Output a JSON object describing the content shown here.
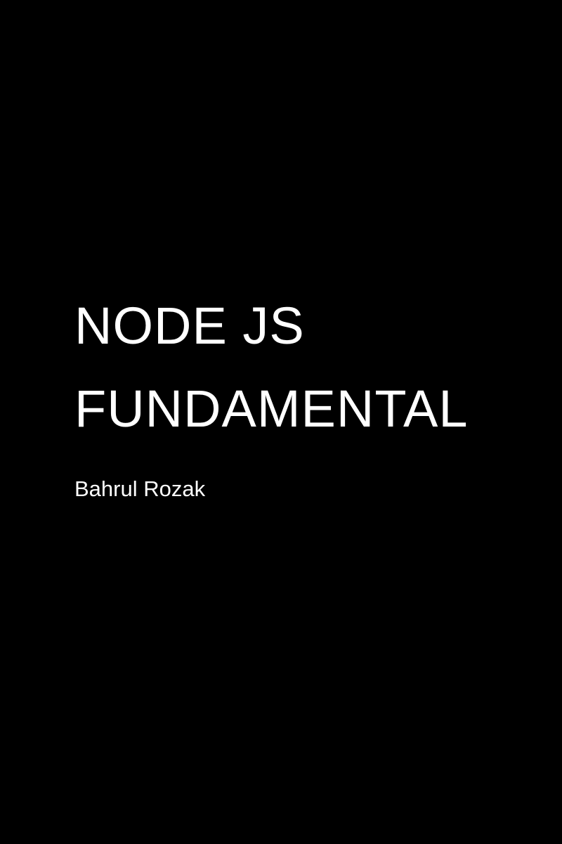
{
  "cover": {
    "background_color": "#000000",
    "text_color": "#ffffff",
    "title_lines": [
      "NODE JS",
      "FUNDAMENTAL"
    ],
    "author": "Bahrul Rozak"
  }
}
